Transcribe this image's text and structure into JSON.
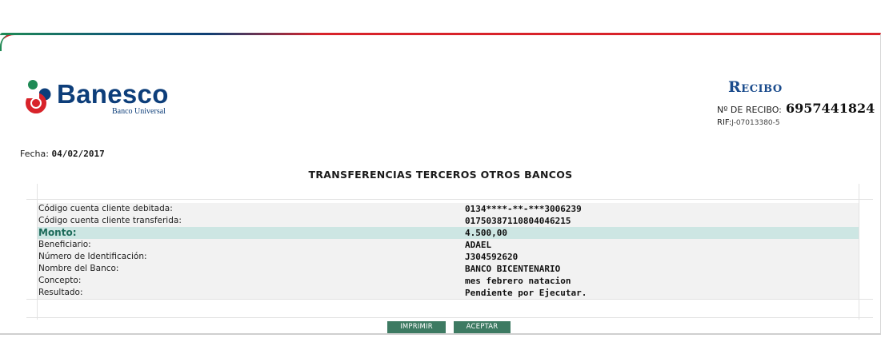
{
  "brand": {
    "name": "Banesco",
    "subtitle": "Banco Universal",
    "colors": {
      "red": "#d8232a",
      "navy": "#0d3e7a",
      "green": "#1f8a55",
      "teal": "#3d7a62"
    }
  },
  "receipt": {
    "title": "Recibo",
    "number_label": "Nº DE RECIBO:",
    "number": "6957441824",
    "rif_label": "RIF:",
    "rif_value": "J-07013380-5"
  },
  "date": {
    "label": "Fecha:",
    "value": "04/02/2017"
  },
  "section_title": "TRANSFERENCIAS TERCEROS OTROS BANCOS",
  "details": [
    {
      "label": "Código cuenta cliente debitada:",
      "value": "0134****-**-***3006239"
    },
    {
      "label": "Código cuenta cliente transferida:",
      "value": "01750387110804046215"
    },
    {
      "label": "Monto:",
      "value": "4.500,00",
      "highlight": true
    },
    {
      "label": "Beneficiario:",
      "value": "ADAEL"
    },
    {
      "label": "Número de Identificación:",
      "value": "J304592620"
    },
    {
      "label": "Nombre del Banco:",
      "value": "BANCO BICENTENARIO"
    },
    {
      "label": "Concepto:",
      "value": "mes febrero natacion"
    },
    {
      "label": "Resultado:",
      "value": "Pendiente por Ejecutar."
    }
  ],
  "actions": {
    "print_label": "IMPRIMIR",
    "accept_label": "ACEPTAR"
  }
}
